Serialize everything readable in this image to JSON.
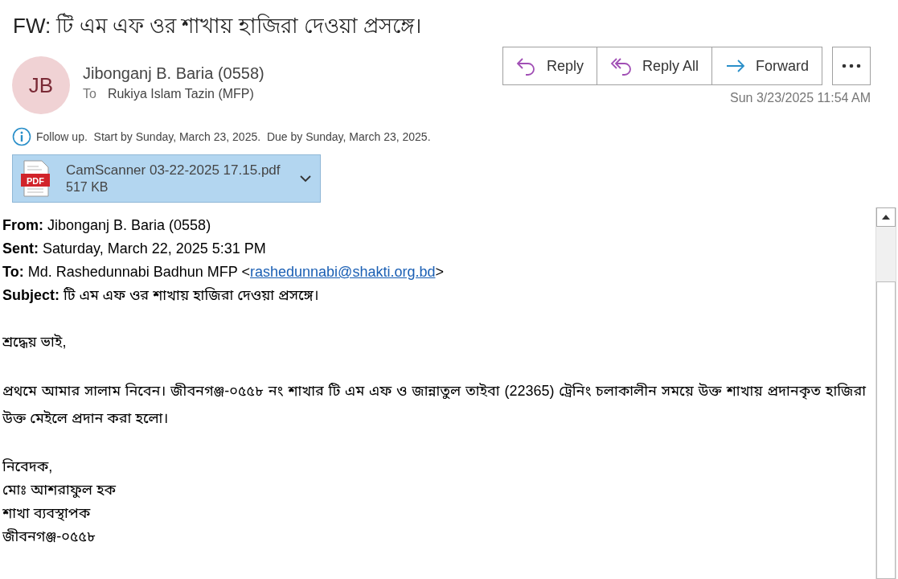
{
  "title": "FW: টি এম এফ ওর শাখায় হাজিরা দেওয়া প্রসঙ্গে।",
  "sender": {
    "initials": "JB",
    "name": "Jibonganj B. Baria (0558)",
    "to_label": "To",
    "to": "Rukiya Islam Tazin (MFP)"
  },
  "actions": [
    {
      "label": "Reply",
      "kind": "reply"
    },
    {
      "label": "Reply All",
      "kind": "replyall"
    },
    {
      "label": "Forward",
      "kind": "forward"
    }
  ],
  "received": "Sun 3/23/2025 11:54 AM",
  "info_bar": "Follow up.  Start by Sunday, March 23, 2025.  Due by Sunday, March 23, 2025.",
  "attachment": {
    "name": "CamScanner 03-22-2025 17.15.pdf",
    "size": "517 KB",
    "type_label": "PDF"
  },
  "body": {
    "headers": [
      {
        "kind": "text",
        "text": "**From:** Jibonganj B. Baria (0558)"
      },
      {
        "kind": "text",
        "text": "**Sent:** Saturday, March 22, 2025 5:31 PM"
      },
      {
        "kind": "link",
        "text": "**To:** Md. Rashedunnabi Badhun MFP <",
        "link": "rashedunnabi@shakti.org.bd",
        "after": ">"
      },
      {
        "kind": "text",
        "text": "**Subject:** টি এম এফ ওর শাখায় হাজিরা দেওয়া প্রসঙ্গে।"
      }
    ],
    "greeting": "শ্রদ্ধেয় ভাই,",
    "paragraph": "প্রথমে আমার সালাম নিবেন। জীবনগঞ্জ-০৫৫৮ নং শাখার টি এম এফ ও জান্নাতুল তাইবা (22365) ট্রেনিং চলাকালীন সময়ে উক্ত শাখায় প্রদানকৃত হাজিরা উক্ত মেইলে প্রদান করা হলো।",
    "signature": [
      "নিবেদক,",
      "মোঃ আশরাফুল হক",
      "শাখা ব্যবস্থাপক",
      "জীবনগঞ্জ-০৫৫৮"
    ]
  }
}
